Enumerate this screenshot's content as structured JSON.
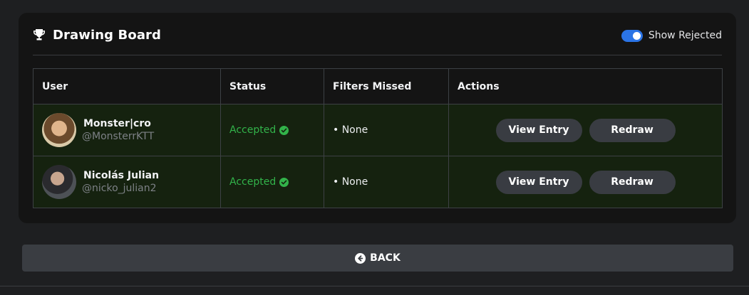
{
  "header": {
    "title": "Drawing Board",
    "title_icon": "trophy-icon",
    "toggle": {
      "label": "Show Rejected",
      "on": true,
      "accent": "#2b74e6"
    }
  },
  "table": {
    "columns": [
      "User",
      "Status",
      "Filters Missed",
      "Actions"
    ],
    "rows": [
      {
        "name": "Monster|cro",
        "handle": "@MonsterrKTT",
        "status": "Accepted",
        "filters": "• None",
        "view_label": "View Entry",
        "redraw_label": "Redraw"
      },
      {
        "name": "Nicolás Julian",
        "handle": "@nicko_julian2",
        "status": "Accepted",
        "filters": "• None",
        "view_label": "View Entry",
        "redraw_label": "Redraw"
      }
    ],
    "status_color": "#32b34a",
    "row_background": "#15220f"
  },
  "footer": {
    "back_label": "BACK",
    "back_icon": "arrow-left-circle-icon"
  }
}
